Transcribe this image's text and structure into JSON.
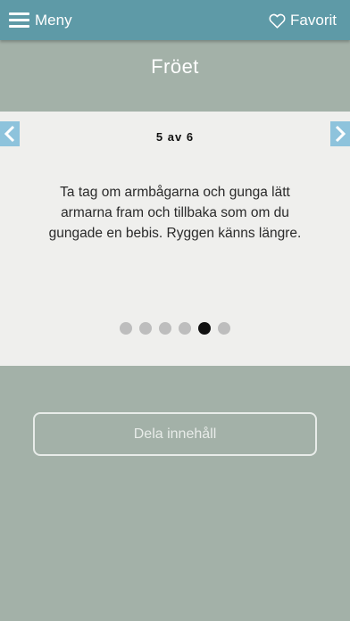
{
  "topbar": {
    "menu_label": "Meny",
    "favorite_label": "Favorit"
  },
  "page": {
    "title": "Fröet"
  },
  "card": {
    "counter": "5 av 6",
    "text": "Ta tag om armbågarna och gunga lätt armarna fram och tillbaka som om du gungade en bebis. Ryggen känns längre.",
    "pager": {
      "total": 6,
      "current": 5
    }
  },
  "share": {
    "label": "Dela innehåll"
  },
  "colors": {
    "header": "#5e9aa7",
    "background": "#a3b1a8",
    "card": "#efefed",
    "arrow": "#8ec3dc"
  }
}
